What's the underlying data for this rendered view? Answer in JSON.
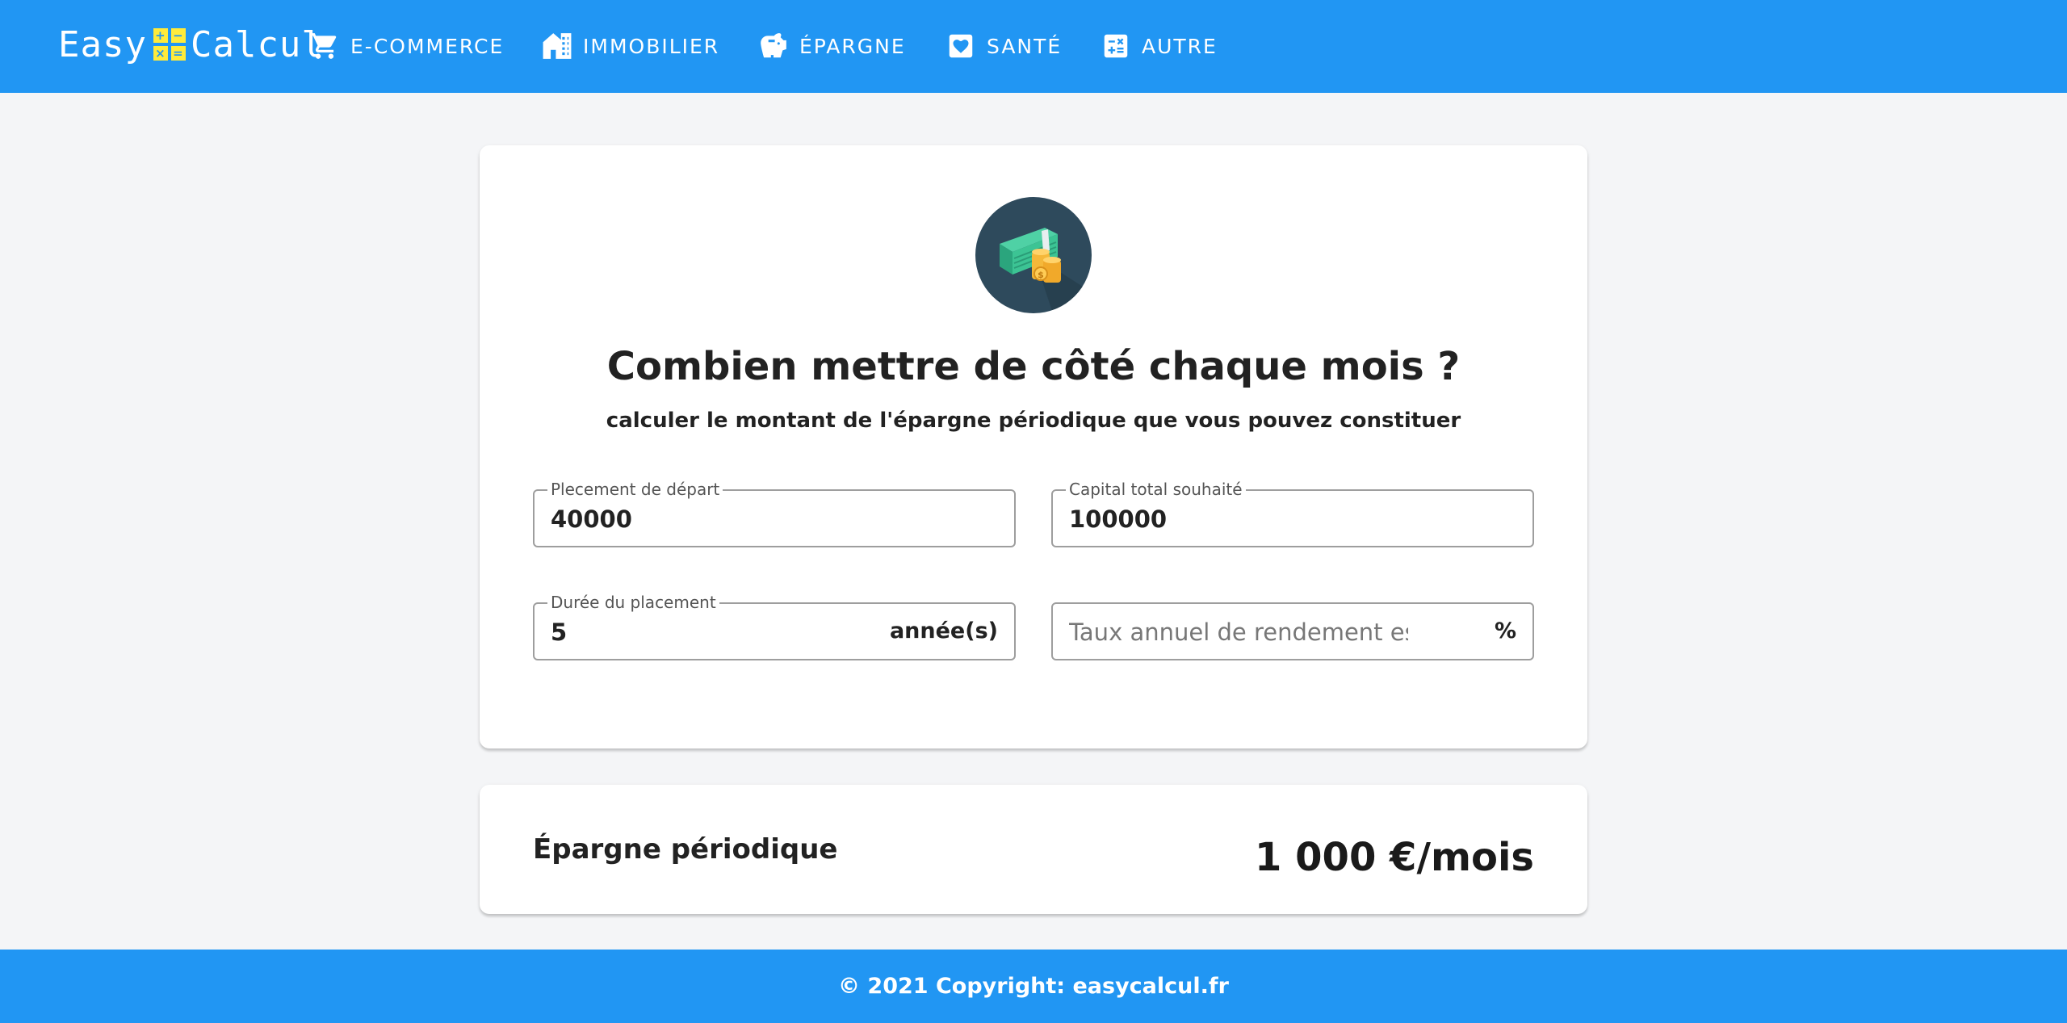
{
  "navbar": {
    "brand_left": "Easy",
    "brand_right": "Calcul",
    "brand_symbols": [
      "+",
      "−",
      "×",
      "="
    ],
    "items": [
      {
        "label": "E-COMMERCE",
        "icon": "cart-icon"
      },
      {
        "label": "IMMOBILIER",
        "icon": "building-icon"
      },
      {
        "label": "ÉPARGNE",
        "icon": "piggy-bank-icon"
      },
      {
        "label": "SANTÉ",
        "icon": "heart-icon"
      },
      {
        "label": "AUTRE",
        "icon": "calculator-icon"
      }
    ],
    "color": "#2196f3"
  },
  "main": {
    "hero_icon": "money-icon",
    "title": "Combien mettre de côté chaque mois ?",
    "subtitle": "calculer le montant de l'épargne périodique que vous pouvez constituer",
    "fields": {
      "initial": {
        "label": "Plecement de départ",
        "value": "40000"
      },
      "capital": {
        "label": "Capital total souhaité",
        "value": "100000"
      },
      "duration": {
        "label": "Durée du placement",
        "value": "5",
        "suffix": "année(s)"
      },
      "rate": {
        "placeholder": "Taux annuel de rendement espéré",
        "value": "",
        "suffix": "%"
      }
    }
  },
  "result": {
    "label": "Épargne périodique",
    "value": "1 000 €/mois"
  },
  "footer": {
    "text": "© 2021 Copyright: easycalcul.fr"
  }
}
